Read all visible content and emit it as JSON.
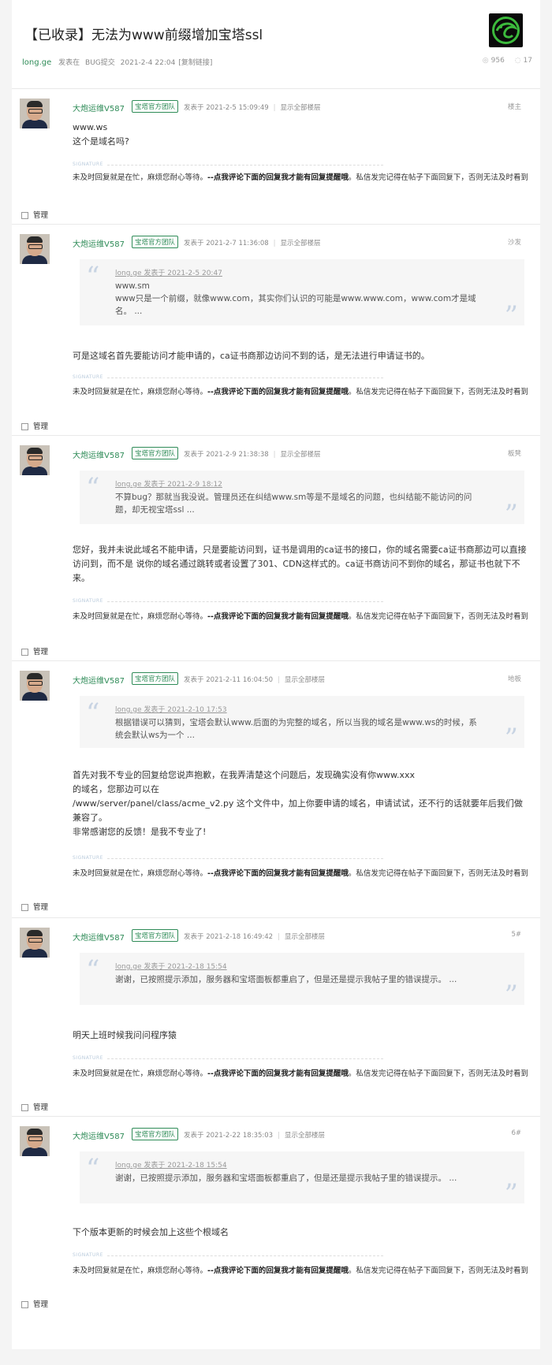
{
  "header": {
    "title": "【已收录】无法为www前缀增加宝塔ssl",
    "author": "long.ge",
    "posted_in_label": "发表在",
    "board": "BUG提交",
    "datetime": "2021-2-4 22:04",
    "copy_link": "[复制链接]",
    "views": "956",
    "replies": "17"
  },
  "signature_label": "SIGNATURE",
  "signature_text_a": "未及时回复就是在忙，麻烦您耐心等待。",
  "signature_text_b": "--点我评论下面的回复我才能有回复提醒哦",
  "signature_text_c": "。私信发完记得在帖子下面回复下，否则无法及时看到",
  "manage_label": "管理",
  "show_all_label": "显示全部楼层",
  "posts": [
    {
      "user": "大炮运维V587",
      "badge": "宝塔官方团队",
      "time": "发表于 2021-2-5 15:09:49",
      "floor": "楼主",
      "content_lines": [
        "www.ws",
        "这个是域名吗?"
      ]
    },
    {
      "user": "大炮运维V587",
      "badge": "宝塔官方团队",
      "time": "发表于 2021-2-7 11:36:08",
      "floor": "沙发",
      "quote_head": "long.ge 发表于 2021-2-5 20:47",
      "quote_body": "www.sm\nwww只是一个前缀，就像www.com，其实你们认识的可能是www.www.com，www.com才是域名。 ...",
      "content": "可是这域名首先要能访问才能申请的，ca证书商那边访问不到的话，是无法进行申请证书的。"
    },
    {
      "user": "大炮运维V587",
      "badge": "宝塔官方团队",
      "time": "发表于 2021-2-9 21:38:38",
      "floor": "板凳",
      "quote_head": "long.ge 发表于 2021-2-9 18:12",
      "quote_body": "不算bug？那就当我没说。管理员还在纠结www.sm等是不是域名的问题，也纠结能不能访问的问题，却无视宝塔ssl ...",
      "content": "您好，我并未说此域名不能申请，只是要能访问到，证书是调用的ca证书的接口，你的域名需要ca证书商那边可以直接访问到，而不是 说你的域名通过跳转或者设置了301、CDN这样式的。ca证书商访问不到你的域名，那证书也就下不来。"
    },
    {
      "user": "大炮运维V587",
      "badge": "宝塔官方团队",
      "time": "发表于 2021-2-11 16:04:50",
      "floor": "地板",
      "quote_head": "long.ge 发表于 2021-2-10 17:53",
      "quote_body": "根据错误可以猜到，宝塔会默认www.后面的为完整的域名，所以当我的域名是www.ws的时候，系统会默认ws为一个 ...",
      "content_lines": [
        "首先对我不专业的回复给您说声抱歉，在我弄清楚这个问题后，发现确实没有你www.xxx",
        "的域名，您那边可以在",
        "/www/server/panel/class/acme_v2.py 这个文件中，加上你要申请的域名，申请试试，还不行的话就要年后我们做兼容了。",
        "非常感谢您的反馈！是我不专业了!"
      ]
    },
    {
      "user": "大炮运维V587",
      "badge": "宝塔官方团队",
      "time": "发表于 2021-2-18 16:49:42",
      "floor": "5#",
      "quote_head": "long.ge 发表于 2021-2-18 15:54",
      "quote_body": "谢谢，已按照提示添加，服务器和宝塔面板都重启了，但是还是提示我帖子里的错误提示。 ...",
      "content": "明天上班时候我问问程序猿"
    },
    {
      "user": "大炮运维V587",
      "badge": "宝塔官方团队",
      "time": "发表于 2021-2-22 18:35:03",
      "floor": "6#",
      "quote_head": "long.ge 发表于 2021-2-18 15:54",
      "quote_body": "谢谢，已按照提示添加，服务器和宝塔面板都重启了，但是还是提示我帖子里的错误提示。 ...",
      "content": "下个版本更新的时候会加上这些个根域名"
    }
  ]
}
